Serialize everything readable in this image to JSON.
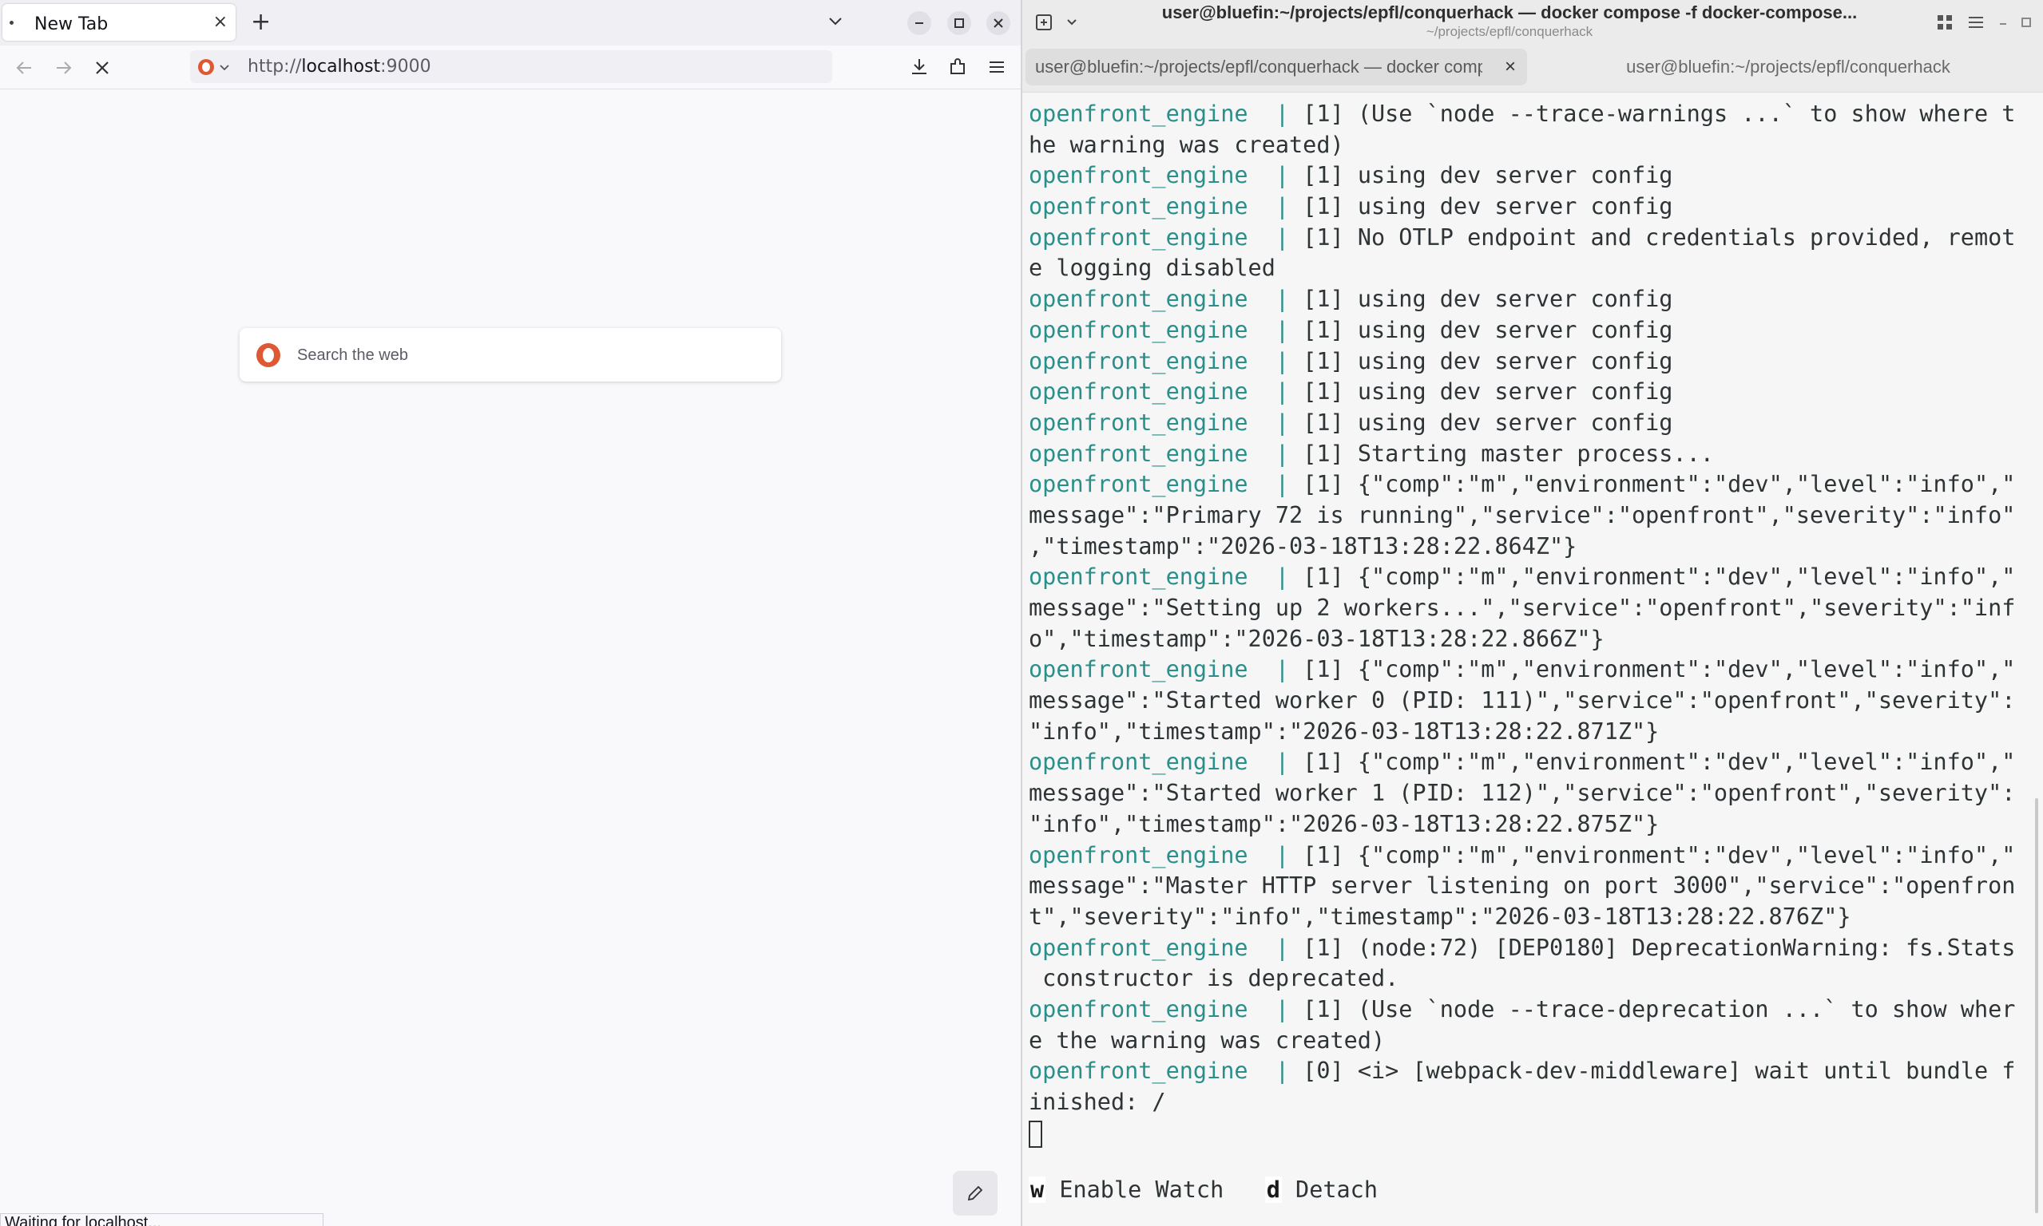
{
  "browser": {
    "tab": {
      "title": "New Tab",
      "close": "×"
    },
    "new_tab_symbol": "+",
    "url": {
      "prefix": "http://",
      "host": "localhost",
      "port": ":9000"
    },
    "search_placeholder": "Search the web",
    "status_text": "Waiting for localhost..."
  },
  "terminal": {
    "title": "user@bluefin:~/projects/epfl/conquerhack — docker compose -f docker-compose...",
    "subtitle": "~/projects/epfl/conquerhack",
    "tabs": [
      {
        "label": "user@bluefin:~/projects/epfl/conquerhack — docker compose -f docker-compose",
        "close": "×"
      },
      {
        "label": "user@bluefin:~/projects/epfl/conquerhack"
      }
    ],
    "separator": "  | ",
    "lines": [
      {
        "svc": "openfront_engine",
        "text": "[1] (Use `node --trace-warnings ...` to show where t"
      },
      {
        "svc": "",
        "text": "he warning was created)"
      },
      {
        "svc": "openfront_engine",
        "text": "[1] using dev server config"
      },
      {
        "svc": "openfront_engine",
        "text": "[1] using dev server config"
      },
      {
        "svc": "openfront_engine",
        "text": "[1] No OTLP endpoint and credentials provided, remot"
      },
      {
        "svc": "",
        "text": "e logging disabled"
      },
      {
        "svc": "openfront_engine",
        "text": "[1] using dev server config"
      },
      {
        "svc": "openfront_engine",
        "text": "[1] using dev server config"
      },
      {
        "svc": "openfront_engine",
        "text": "[1] using dev server config"
      },
      {
        "svc": "openfront_engine",
        "text": "[1] using dev server config"
      },
      {
        "svc": "openfront_engine",
        "text": "[1] using dev server config"
      },
      {
        "svc": "openfront_engine",
        "text": "[1] Starting master process..."
      },
      {
        "svc": "openfront_engine",
        "text": "[1] {\"comp\":\"m\",\"environment\":\"dev\",\"level\":\"info\",\""
      },
      {
        "svc": "",
        "text": "message\":\"Primary 72 is running\",\"service\":\"openfront\",\"severity\":\"info\""
      },
      {
        "svc": "",
        "text": ",\"timestamp\":\"2026-03-18T13:28:22.864Z\"}"
      },
      {
        "svc": "openfront_engine",
        "text": "[1] {\"comp\":\"m\",\"environment\":\"dev\",\"level\":\"info\",\""
      },
      {
        "svc": "",
        "text": "message\":\"Setting up 2 workers...\",\"service\":\"openfront\",\"severity\":\"inf"
      },
      {
        "svc": "",
        "text": "o\",\"timestamp\":\"2026-03-18T13:28:22.866Z\"}"
      },
      {
        "svc": "openfront_engine",
        "text": "[1] {\"comp\":\"m\",\"environment\":\"dev\",\"level\":\"info\",\""
      },
      {
        "svc": "",
        "text": "message\":\"Started worker 0 (PID: 111)\",\"service\":\"openfront\",\"severity\":"
      },
      {
        "svc": "",
        "text": "\"info\",\"timestamp\":\"2026-03-18T13:28:22.871Z\"}"
      },
      {
        "svc": "openfront_engine",
        "text": "[1] {\"comp\":\"m\",\"environment\":\"dev\",\"level\":\"info\",\""
      },
      {
        "svc": "",
        "text": "message\":\"Started worker 1 (PID: 112)\",\"service\":\"openfront\",\"severity\":"
      },
      {
        "svc": "",
        "text": "\"info\",\"timestamp\":\"2026-03-18T13:28:22.875Z\"}"
      },
      {
        "svc": "openfront_engine",
        "text": "[1] {\"comp\":\"m\",\"environment\":\"dev\",\"level\":\"info\",\""
      },
      {
        "svc": "",
        "text": "message\":\"Master HTTP server listening on port 3000\",\"service\":\"openfron"
      },
      {
        "svc": "",
        "text": "t\",\"severity\":\"info\",\"timestamp\":\"2026-03-18T13:28:22.876Z\"}"
      },
      {
        "svc": "openfront_engine",
        "text": "[1] (node:72) [DEP0180] DeprecationWarning: fs.Stats"
      },
      {
        "svc": "",
        "text": " constructor is deprecated."
      },
      {
        "svc": "openfront_engine",
        "text": "[1] (Use `node --trace-deprecation ...` to show wher"
      },
      {
        "svc": "",
        "text": "e the warning was created)"
      },
      {
        "svc": "openfront_engine",
        "text": "[0] <i> [webpack-dev-middleware] wait until bundle f"
      },
      {
        "svc": "",
        "text": "inished: /"
      }
    ],
    "footer": {
      "watch_key": "w",
      "watch_label": " Enable Watch",
      "detach_key": "d",
      "detach_label": " Detach"
    }
  }
}
